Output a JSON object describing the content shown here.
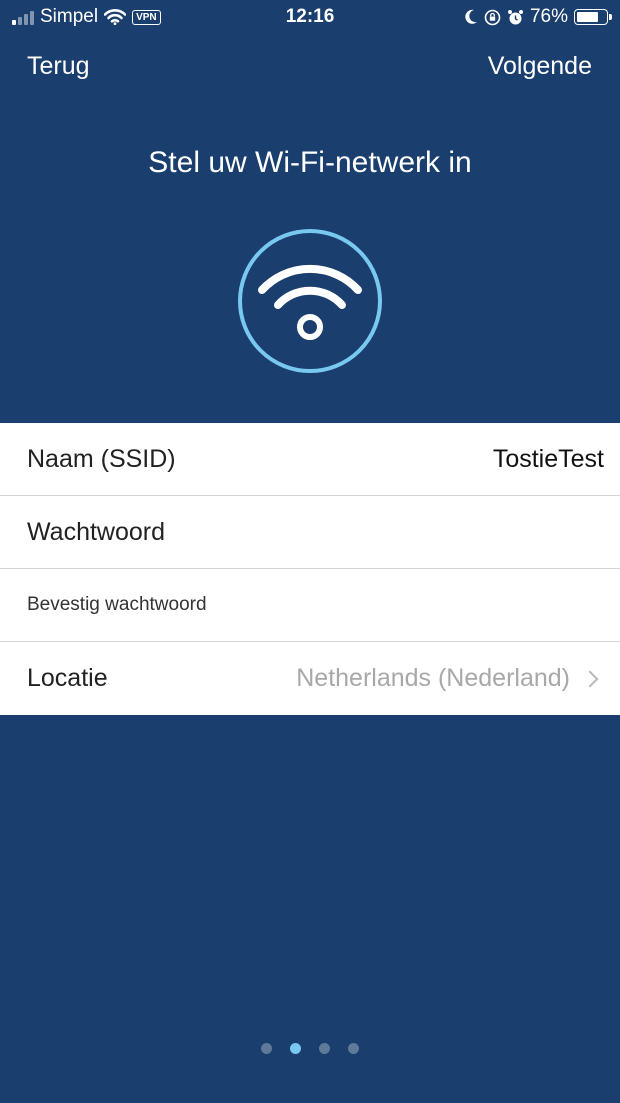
{
  "status_bar": {
    "carrier": "Simpel",
    "vpn_label": "VPN",
    "time": "12:16",
    "battery_percent": "76%",
    "battery_level": 0.76,
    "signal_bars_active": 1,
    "signal_bars_total": 4,
    "icons": [
      "signal-icon",
      "wifi-icon",
      "vpn-badge",
      "moon-icon",
      "orientation-lock-icon",
      "alarm-icon",
      "battery-icon"
    ]
  },
  "nav": {
    "back_label": "Terug",
    "next_label": "Volgende"
  },
  "title": "Stel uw Wi-Fi-netwerk in",
  "hero_icon": "wifi-icon",
  "form": {
    "ssid": {
      "label": "Naam (SSID)",
      "value": "TostieTest"
    },
    "password": {
      "label": "Wachtwoord",
      "value": ""
    },
    "confirm_password": {
      "label": "Bevestig wachtwoord",
      "value": ""
    },
    "location": {
      "label": "Locatie",
      "value": "Netherlands (Nederland)"
    }
  },
  "pagination": {
    "total": 4,
    "active_index": 1
  },
  "colors": {
    "background": "#1a3f6e",
    "accent": "#79c8ef",
    "form_background": "#ffffff",
    "muted_text": "#a8a8a8"
  }
}
